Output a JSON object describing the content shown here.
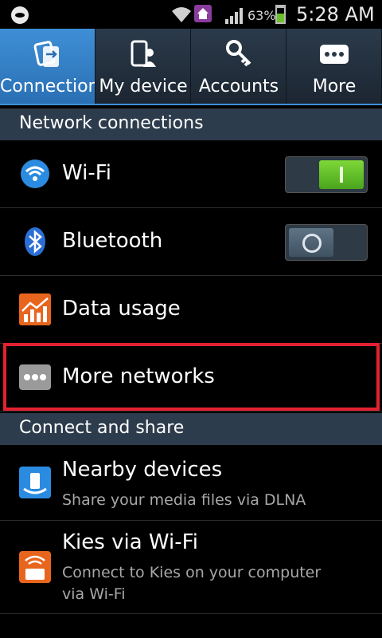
{
  "status_bar": {
    "battery_percent": "63%",
    "battery_level": 0.63,
    "time": "5:28 AM",
    "icons": [
      "notification-icon",
      "wifi-signal-icon",
      "home-icon",
      "cell-signal-icon",
      "battery-icon"
    ]
  },
  "tabs": [
    {
      "label": "Connections",
      "icon": "connections-icon",
      "active": true
    },
    {
      "label": "My device",
      "icon": "device-icon",
      "active": false
    },
    {
      "label": "Accounts",
      "icon": "key-icon",
      "active": false
    },
    {
      "label": "More",
      "icon": "more-dots-icon",
      "active": false
    }
  ],
  "sections": {
    "network": "Network connections",
    "connect": "Connect and share"
  },
  "items": {
    "wifi": {
      "title": "Wi-Fi",
      "toggle": "on",
      "icon": "wifi-icon"
    },
    "bluetooth": {
      "title": "Bluetooth",
      "toggle": "off",
      "icon": "bluetooth-icon"
    },
    "data_usage": {
      "title": "Data usage",
      "icon": "data-usage-icon"
    },
    "more_networks": {
      "title": "More networks",
      "icon": "more-networks-icon"
    },
    "nearby": {
      "title": "Nearby devices",
      "subtitle": "Share your media files via DLNA",
      "icon": "nearby-devices-icon"
    },
    "kies": {
      "title": "Kies via Wi-Fi",
      "subtitle_line1": "Connect to Kies on your computer",
      "subtitle_line2": "via Wi-Fi",
      "icon": "kies-icon"
    }
  },
  "colors": {
    "accent": "#3f8fd6",
    "toggle_on": "#5cbf22",
    "highlight": "#e32230",
    "section_bg": "#2d3c4c"
  }
}
